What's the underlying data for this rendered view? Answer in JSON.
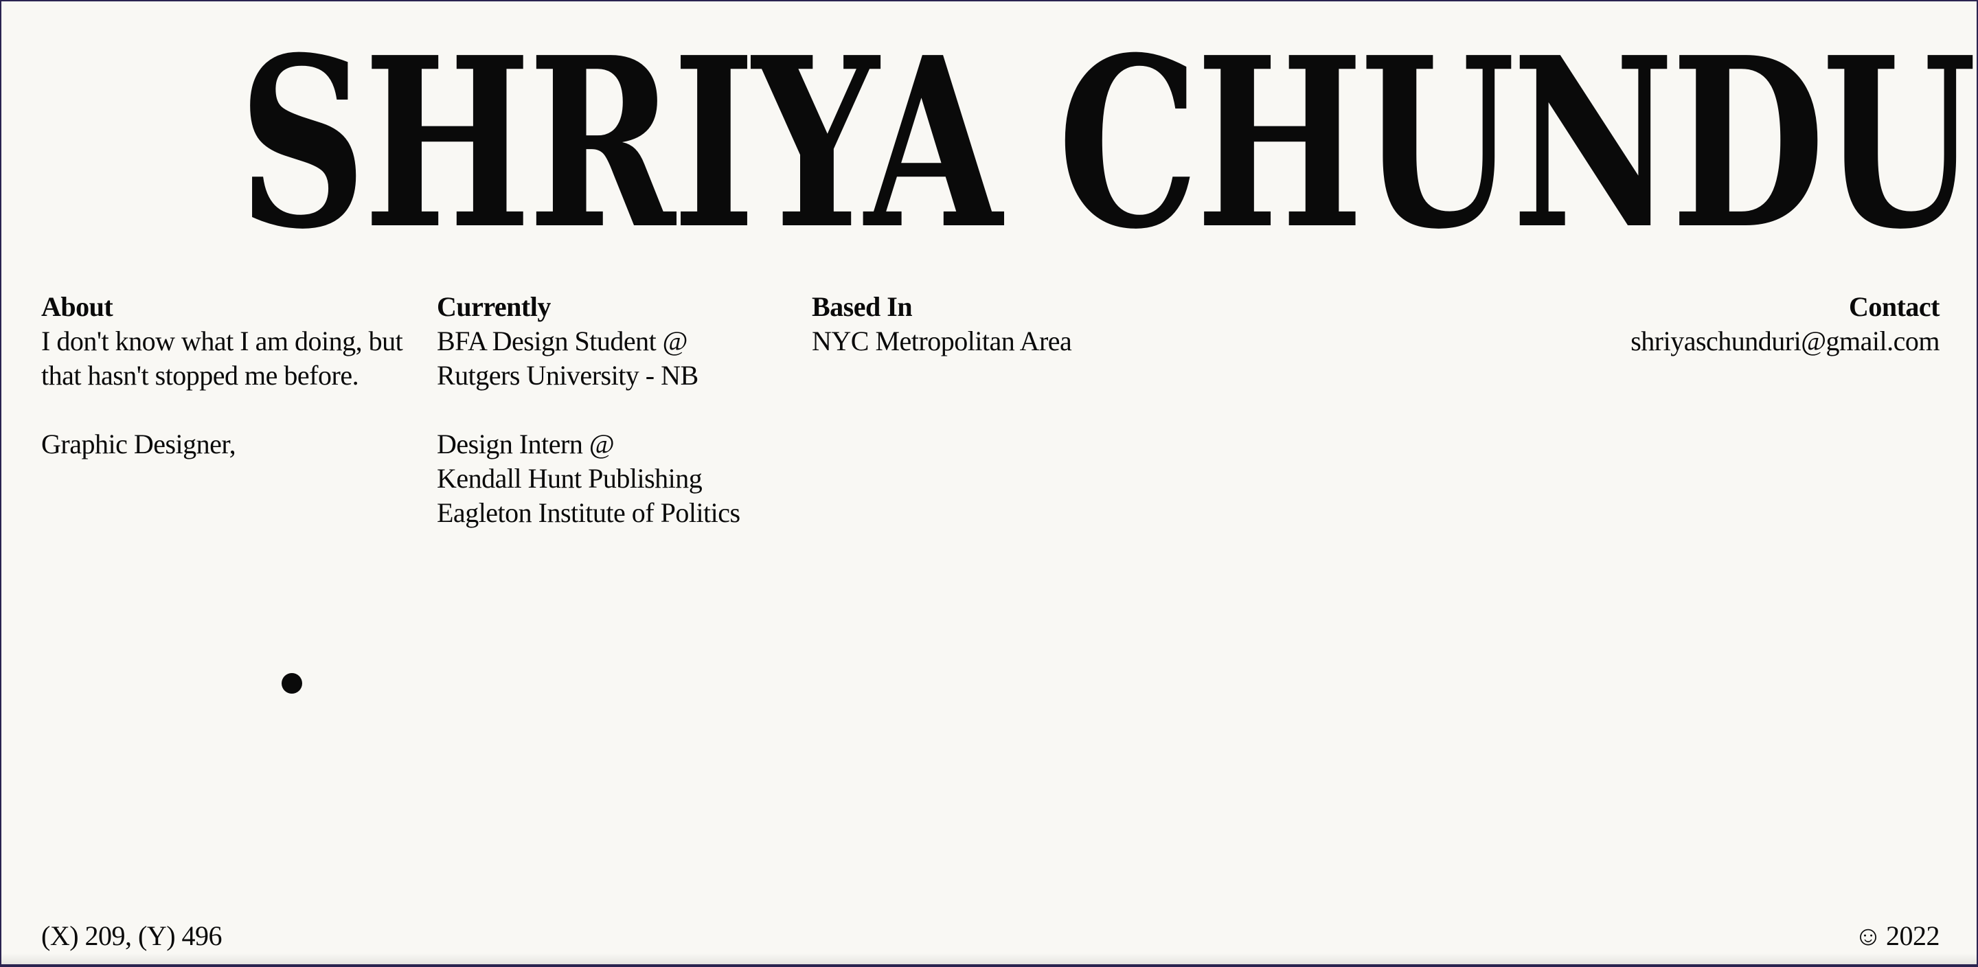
{
  "header": {
    "name": "SHRIYA CHUNDURI"
  },
  "about": {
    "heading": "About",
    "lines": [
      "I don't know what I am doing, but",
      "that hasn't stopped me before."
    ],
    "role": "Graphic Designer,"
  },
  "currently": {
    "heading": "Currently",
    "student_lines": [
      "BFA Design Student @",
      "Rutgers University - NB"
    ],
    "intern_lines": [
      "Design Intern @",
      "Kendall Hunt Publishing",
      "Eagleton Institute of Politics"
    ]
  },
  "based_in": {
    "heading": "Based In",
    "location": "NYC Metropolitan Area"
  },
  "contact": {
    "heading": "Contact",
    "email": "shriyaschunduri@gmail.com"
  },
  "footer": {
    "coordinates": "(X) 209, (Y) 496",
    "smiley_icon": "☺",
    "year": "2022"
  },
  "colors": {
    "background": "#f9f8f4",
    "text": "#0a0a0a",
    "window_frame": "#2a2450"
  }
}
